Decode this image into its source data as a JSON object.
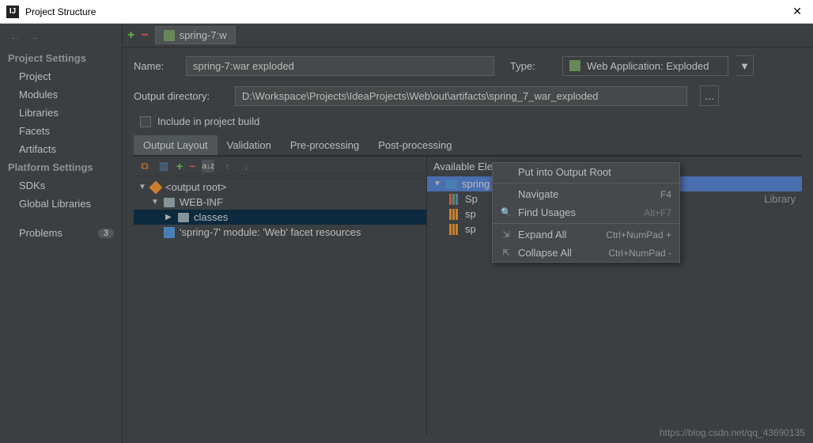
{
  "titlebar": {
    "title": "Project Structure"
  },
  "sidebar": {
    "section1": "Project Settings",
    "items1": [
      "Project",
      "Modules",
      "Libraries",
      "Facets",
      "Artifacts"
    ],
    "section2": "Platform Settings",
    "items2": [
      "SDKs",
      "Global Libraries"
    ],
    "problems": "Problems",
    "problems_count": "3"
  },
  "tab_open": "spring-7:w",
  "form": {
    "name_label": "Name:",
    "name_value": "spring-7:war exploded",
    "type_label": "Type:",
    "type_value": "Web Application: Exploded",
    "outdir_label": "Output directory:",
    "outdir_value": "D:\\Workspace\\Projects\\IdeaProjects\\Web\\out\\artifacts\\spring_7_war_exploded",
    "include_label": "Include in project build"
  },
  "tabs": [
    "Output Layout",
    "Validation",
    "Pre-processing",
    "Post-processing"
  ],
  "tree": {
    "root": "<output root>",
    "webinf": "WEB-INF",
    "classes": "classes",
    "facet": "'spring-7' module: 'Web' facet resources"
  },
  "available": {
    "header": "Available Elements",
    "spring_folder": "spring",
    "lib_trunc": "Library",
    "items": [
      "Sp",
      "sp",
      "sp"
    ]
  },
  "ctx": {
    "put": "Put into Output Root",
    "nav": "Navigate",
    "nav_sc": "F4",
    "find": "Find Usages",
    "find_sc": "Alt+F7",
    "expand": "Expand All",
    "expand_sc": "Ctrl+NumPad +",
    "collapse": "Collapse All",
    "collapse_sc": "Ctrl+NumPad -"
  },
  "watermark": "https://blog.csdn.net/qq_43690135"
}
